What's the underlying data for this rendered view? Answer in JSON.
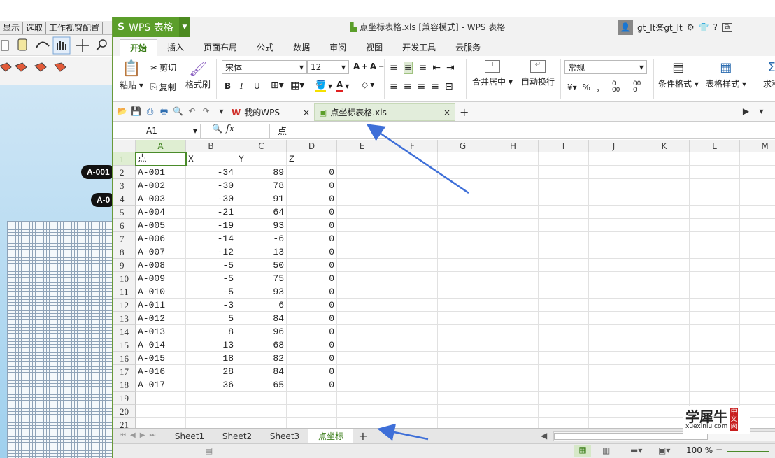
{
  "background_app": {
    "menu": [
      "显示",
      "选取",
      "工作视窗配置"
    ],
    "markers": [
      "A-001",
      "A-0"
    ]
  },
  "window": {
    "app_logo": "WPS 表格",
    "doc_title": "点坐标表格.xls [兼容模式] - WPS 表格",
    "user": "gt_lt楽gt_lt",
    "help": "?"
  },
  "ribbon_tabs": [
    "开始",
    "插入",
    "页面布局",
    "公式",
    "数据",
    "审阅",
    "视图",
    "开发工具",
    "云服务"
  ],
  "ribbon": {
    "paste": "粘贴",
    "cut": "剪切",
    "copy": "复制",
    "format_painter": "格式刷",
    "font_name": "宋体",
    "font_size": "12",
    "merge_center": "合并居中",
    "wrap_text": "自动换行",
    "number_format": "常规",
    "percent": "%",
    "comma": "，",
    "inc_decimal": ".0 .00",
    "dec_decimal": ".00 .0",
    "conditional_format": "条件格式",
    "table_style": "表格样式",
    "sum": "求和"
  },
  "doc_tabs": [
    {
      "label": "我的WPS",
      "close": "×"
    },
    {
      "label": "点坐标表格.xls",
      "close": "×"
    }
  ],
  "new_tab": "+",
  "formula_bar": {
    "name_box": "A1",
    "fx": "fx",
    "value": "点"
  },
  "columns": [
    "A",
    "B",
    "C",
    "D",
    "E",
    "F",
    "G",
    "H",
    "I",
    "J",
    "K",
    "L",
    "M"
  ],
  "row_numbers": [
    "1",
    "2",
    "3",
    "4",
    "5",
    "6",
    "7",
    "8",
    "9",
    "10",
    "11",
    "12",
    "13",
    "14",
    "15",
    "16",
    "17",
    "18",
    "19",
    "20",
    "21"
  ],
  "table": {
    "header": [
      "点",
      "X",
      "Y",
      "Z"
    ],
    "rows": [
      [
        "A-001",
        "-34",
        "89",
        "0"
      ],
      [
        "A-002",
        "-30",
        "78",
        "0"
      ],
      [
        "A-003",
        "-30",
        "91",
        "0"
      ],
      [
        "A-004",
        "-21",
        "64",
        "0"
      ],
      [
        "A-005",
        "-19",
        "93",
        "0"
      ],
      [
        "A-006",
        "-14",
        "-6",
        "0"
      ],
      [
        "A-007",
        "-12",
        "13",
        "0"
      ],
      [
        "A-008",
        "-5",
        "50",
        "0"
      ],
      [
        "A-009",
        "-5",
        "75",
        "0"
      ],
      [
        "A-010",
        "-5",
        "93",
        "0"
      ],
      [
        "A-011",
        "-3",
        "6",
        "0"
      ],
      [
        "A-012",
        "5",
        "84",
        "0"
      ],
      [
        "A-013",
        "8",
        "96",
        "0"
      ],
      [
        "A-014",
        "13",
        "68",
        "0"
      ],
      [
        "A-015",
        "18",
        "82",
        "0"
      ],
      [
        "A-016",
        "28",
        "84",
        "0"
      ],
      [
        "A-017",
        "36",
        "65",
        "0"
      ]
    ]
  },
  "sheet_tabs": [
    "Sheet1",
    "Sheet2",
    "Sheet3",
    "点坐标"
  ],
  "add_sheet": "+",
  "status": {
    "zoom": "100 %",
    "zoom_minus": "−"
  },
  "watermark": {
    "text": "学犀牛",
    "url": "xuexiniu.com",
    "badge": "中文网"
  },
  "colors": {
    "accent": "#4a8b2a",
    "wps_green": "#5b9e2a",
    "arrow": "#3e6fd8"
  }
}
